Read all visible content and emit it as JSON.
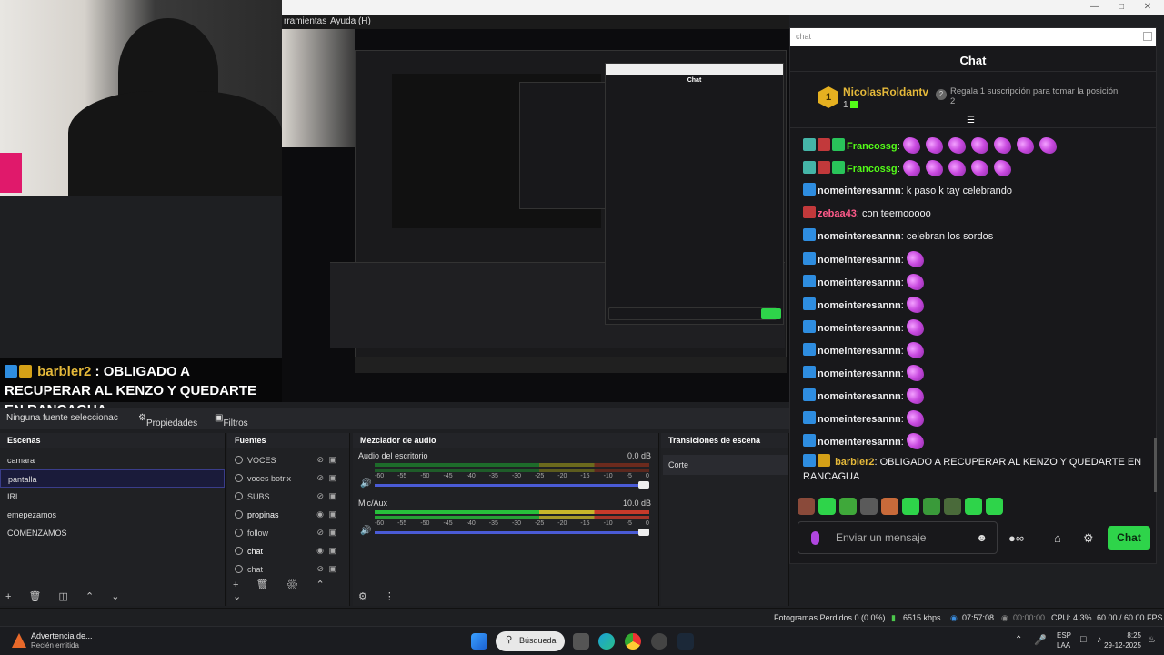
{
  "obs": {
    "menu": {
      "tools": "rramientas",
      "help": "Ayuda (H)"
    },
    "overlay": {
      "user": "barbler2",
      "message": "OBLIGADO A RECUPERAR AL KENZO Y QUEDARTE EN RANCAGUA"
    },
    "sourcebar": {
      "no_source": "Ninguna fuente seleccionac",
      "properties": "Propiedades",
      "filters": "Filtros"
    },
    "scenes": {
      "title": "Escenas",
      "items": [
        "camara",
        "pantalla",
        "IRL",
        "emepezamos",
        "COMENZAMOS"
      ],
      "selected_index": 1
    },
    "sources": {
      "title": "Fuentes",
      "items": [
        {
          "name": "VOCES",
          "visible": false
        },
        {
          "name": "voces botrix",
          "visible": false
        },
        {
          "name": "SUBS",
          "visible": false
        },
        {
          "name": "propinas",
          "visible": true
        },
        {
          "name": "follow",
          "visible": false
        },
        {
          "name": "chat",
          "visible": true
        },
        {
          "name": "chat",
          "visible": false
        },
        {
          "name": "chat",
          "visible": false
        }
      ]
    },
    "mixer": {
      "title": "Mezclador de audio",
      "scale": [
        "-60",
        "-55",
        "-50",
        "-45",
        "-40",
        "-35",
        "-30",
        "-25",
        "-20",
        "-15",
        "-10",
        "-5",
        "0"
      ],
      "channels": [
        {
          "name": "Audio del escritorio",
          "db": "0.0 dB",
          "live": false
        },
        {
          "name": "Mic/Aux",
          "db": "10.0 dB",
          "live": true
        }
      ]
    },
    "transitions": {
      "title": "Transiciones de escena",
      "current": "Corte"
    },
    "status": {
      "dropped": "Fotogramas Perdidos 0 (0.0%)",
      "bitrate": "6515 kbps",
      "live_time": "07:57:08",
      "rec_time": "00:00:00",
      "cpu": "CPU: 4.3%",
      "fps": "60.00 / 60.00 FPS"
    }
  },
  "chat": {
    "url": "chat",
    "title": "Chat",
    "sub_gift": {
      "rank": "1",
      "user": "NicolasRoldantv",
      "count": "1",
      "rank2": "2",
      "cta": "Regala 1 suscripción para tomar la posición 2"
    },
    "messages": [
      {
        "user": "Francossg",
        "text": "",
        "emotes": 7,
        "color": "#53fc18",
        "badges": [
          "b-team",
          "b-red",
          "b-green"
        ]
      },
      {
        "user": "Francossg",
        "text": "",
        "emotes": 5,
        "color": "#53fc18",
        "badges": [
          "b-team",
          "b-red",
          "b-green"
        ]
      },
      {
        "user": "nomeinteresannn",
        "text": "k paso k tay celebrando",
        "emotes": 0,
        "color": "#efeff1",
        "badges": [
          "b-blue"
        ]
      },
      {
        "user": "zebaa43",
        "text": "con teemooooo",
        "emotes": 0,
        "color": "#ff5a8a",
        "badges": [
          "b-red"
        ]
      },
      {
        "user": "nomeinteresannn",
        "text": "celebran los sordos",
        "emotes": 0,
        "color": "#efeff1",
        "badges": [
          "b-blue"
        ]
      },
      {
        "user": "nomeinteresannn",
        "text": "",
        "emotes": 1,
        "color": "#efeff1",
        "badges": [
          "b-blue"
        ]
      },
      {
        "user": "nomeinteresannn",
        "text": "",
        "emotes": 1,
        "color": "#efeff1",
        "badges": [
          "b-blue"
        ]
      },
      {
        "user": "nomeinteresannn",
        "text": "",
        "emotes": 1,
        "color": "#efeff1",
        "badges": [
          "b-blue"
        ]
      },
      {
        "user": "nomeinteresannn",
        "text": "",
        "emotes": 1,
        "color": "#efeff1",
        "badges": [
          "b-blue"
        ]
      },
      {
        "user": "nomeinteresannn",
        "text": "",
        "emotes": 1,
        "color": "#efeff1",
        "badges": [
          "b-blue"
        ]
      },
      {
        "user": "nomeinteresannn",
        "text": "",
        "emotes": 1,
        "color": "#efeff1",
        "badges": [
          "b-blue"
        ]
      },
      {
        "user": "nomeinteresannn",
        "text": "",
        "emotes": 1,
        "color": "#efeff1",
        "badges": [
          "b-blue"
        ]
      },
      {
        "user": "nomeinteresannn",
        "text": "",
        "emotes": 1,
        "color": "#efeff1",
        "badges": [
          "b-blue"
        ]
      },
      {
        "user": "nomeinteresannn",
        "text": "",
        "emotes": 1,
        "color": "#efeff1",
        "badges": [
          "b-blue"
        ]
      }
    ],
    "last_message": {
      "user": "barbler2",
      "text": "OBLIGADO A RECUPERAR AL KENZO Y QUEDARTE EN RANCAGUA",
      "color": "#e5b93a"
    },
    "emote_colors": [
      "#8a4a3a",
      "#2ed44a",
      "#3fa83a",
      "#5a5a5a",
      "#c86a3a",
      "#2ed44a",
      "#3a9a3a",
      "#4a6a3a",
      "#2ed44a",
      "#2ed44a"
    ],
    "input_placeholder": "Enviar un mensaje",
    "send_label": "Chat",
    "accent": "#53fc18"
  },
  "taskbar": {
    "notification_title": "Advertencia de...",
    "notification_sub": "Recién emitida",
    "search": "Búsqueda",
    "lang": "ESP",
    "lang2": "LAA",
    "time": "8:25",
    "date": "29-12-2025"
  }
}
